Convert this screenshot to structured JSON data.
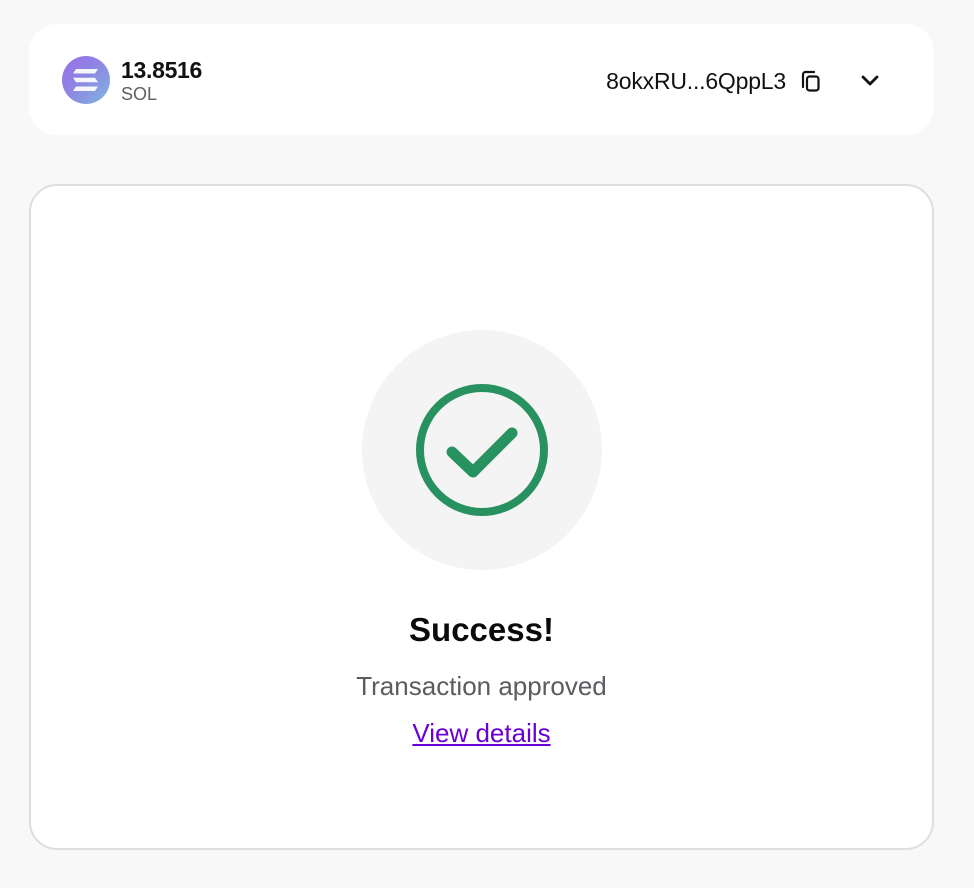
{
  "account": {
    "balance": "13.8516",
    "unit": "SOL",
    "address": "8okxRU...6QppL3"
  },
  "icons": {
    "token": "sol-logo-icon",
    "copy": "copy-icon",
    "dropdown": "chevron-down-icon",
    "status": "check-circle-icon"
  },
  "status": {
    "title": "Success!",
    "subtitle": "Transaction approved",
    "link_label": "View details"
  },
  "colors": {
    "success": "#27915f",
    "link": "#6b00d6"
  }
}
